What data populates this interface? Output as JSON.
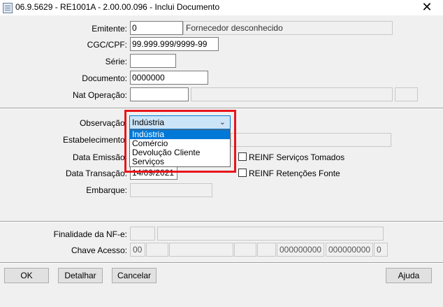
{
  "window": {
    "title": "06.9.5629 - RE1001A - 2.00.00.096 - Inclui Documento",
    "close_glyph": "✕"
  },
  "header_section": {
    "emitente_label": "Emitente:",
    "emitente_value": "0",
    "emitente_name": "Fornecedor desconhecido",
    "cgc_label": "CGC/CPF:",
    "cgc_value": "99.999.999/9999-99",
    "serie_label": "Série:",
    "serie_value": "",
    "documento_label": "Documento:",
    "documento_value": "0000000",
    "nat_label": "Nat Operação:",
    "nat_value": "",
    "nat_desc": "",
    "nat_extra": ""
  },
  "middle_section": {
    "observacao_label": "Observação:",
    "observacao_selected": "Indústria",
    "observacao_options": [
      "Indústria",
      "Comércio",
      "Devolução Cliente",
      "Serviços"
    ],
    "estabelecimento_label": "Estabelecimento:",
    "data_emissao_label": "Data Emissão:",
    "data_transacao_label": "Data Transação:",
    "data_transacao_value": "14/09/2021",
    "embarque_label": "Embarque:",
    "reinf_tomados_label": "REINF Serviços Tomados",
    "reinf_retencoes_label": "REINF Retenções Fonte"
  },
  "nfe_section": {
    "finalidade_label": "Finalidade da NF-e:",
    "chave_label": "Chave Acesso:",
    "chave_parts": [
      "00",
      "",
      "",
      "",
      "",
      "000000000",
      "000000000",
      "0"
    ]
  },
  "buttons": {
    "ok": "OK",
    "detalhar": "Detalhar",
    "cancelar": "Cancelar",
    "ajuda": "Ajuda"
  },
  "colors": {
    "highlight": "#e8151b",
    "selection": "#0078d7"
  }
}
